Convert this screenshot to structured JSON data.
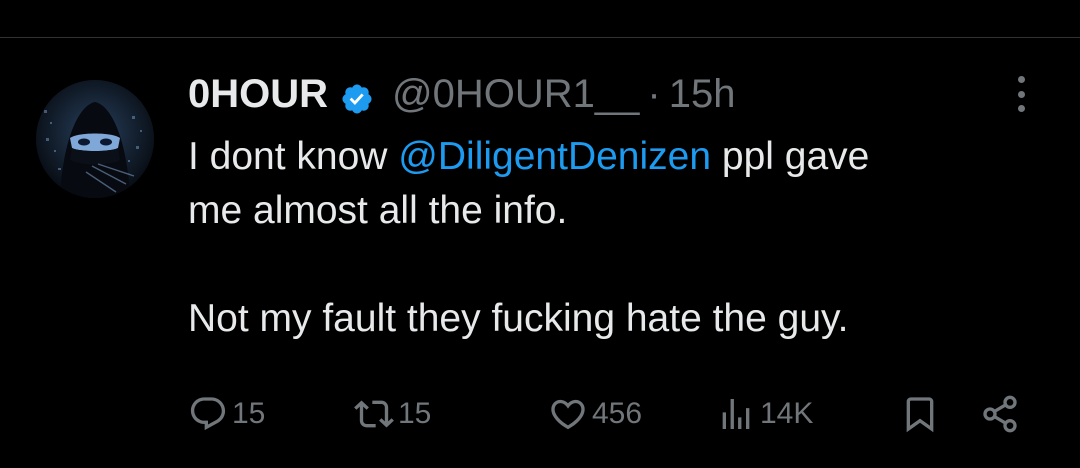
{
  "tweet": {
    "author": {
      "display_name": "0HOUR",
      "handle": "@0HOUR1__",
      "verified": true
    },
    "separator": "·",
    "timestamp": "15h",
    "text": {
      "line1_before": "I dont know ",
      "mention": "@DiligentDenizen",
      "line1_after": " ppl gave",
      "line2": "me almost all the info.",
      "line3": "Not my fault they fucking hate the guy."
    },
    "metrics": {
      "replies": "15",
      "retweets": "15",
      "likes": "456",
      "views": "14K"
    }
  },
  "icons": {
    "verified": "verified-badge-icon",
    "more": "more-options-icon",
    "reply": "reply-icon",
    "retweet": "retweet-icon",
    "like": "heart-icon",
    "views": "views-icon",
    "bookmark": "bookmark-icon",
    "share": "share-icon"
  },
  "colors": {
    "background": "#000000",
    "text": "#e7e9ea",
    "secondary": "#71767b",
    "accent": "#1d9bf0",
    "divider": "#2f3336"
  }
}
